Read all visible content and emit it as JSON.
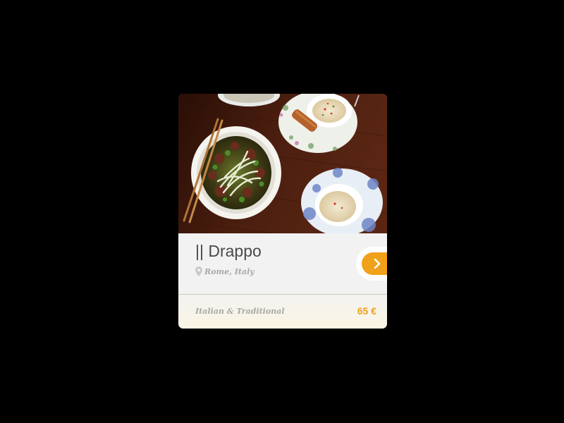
{
  "card": {
    "title": "|| Drappo",
    "location": "Rome, Italy",
    "cuisine": "Italian & Traditional",
    "price": "65 €",
    "accent_color": "#f0a11a",
    "image_alt": "Top-down photo of a bowl of beef pho with chopsticks and small dipping plates on a dark wooden table",
    "icons": {
      "location": "map-pin-icon",
      "next": "chevron-right-icon"
    }
  }
}
